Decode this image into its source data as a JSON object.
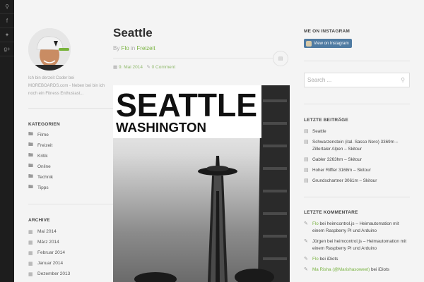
{
  "left_sidebar": {
    "bio": "Ich bin derzeit Coder bei MOREBOARDS.com - Neben bei bin ich noch ein Fitness Enthusiast...",
    "categories_title": "KATEGORIEN",
    "categories": [
      "Filme",
      "Freizeit",
      "Kritik",
      "Online",
      "Technik",
      "Tipps"
    ],
    "archive_title": "ARCHIVE",
    "archive": [
      "Mai 2014",
      "März 2014",
      "Februar 2014",
      "Januar 2014",
      "Dezember 2013"
    ]
  },
  "post": {
    "title": "Seattle",
    "by": "By",
    "author": "Flo",
    "in": "in",
    "category": "Freizeit",
    "date": "9. Mai 2014",
    "comments": "0 Comment",
    "hero_line1": "SEATTLE",
    "hero_line2": "WASHINGTON"
  },
  "right_sidebar": {
    "instagram_title": "ME ON INSTAGRAM",
    "instagram_button": "View on Instagram",
    "search_placeholder": "Search ...",
    "recent_posts_title": "LETZTE BEITRÄGE",
    "recent_posts": [
      "Seattle",
      "Schwarzenstein (ital. Sasso Nero) 3369m – Zillertaler Alpen – Skitour",
      "Gabler 3263hm – Skitour",
      "Hoher Riffler 3168m – Skitour",
      "Grundschartner 3061m – Skitour"
    ],
    "recent_comments_title": "LETZTE KOMMENTARE",
    "recent_comments": [
      {
        "author": "Flo",
        "sep": "bei",
        "post": "heimcontrol.js – Heimautomation mit einem Raspberry PI und Arduino"
      },
      {
        "author": "Jürgen",
        "sep": "bei",
        "post": "heimcontrol.js – Heimautomation mit einem Raspberry PI und Arduino"
      },
      {
        "author": "Flo",
        "sep": "bei",
        "post": "iDiots"
      },
      {
        "author": "Ma Risha (@Marishasoweet)",
        "sep": "bei",
        "post": "iDiots"
      }
    ]
  },
  "colors": {
    "accent": "#79b341",
    "dark_bar": "#1d1d1d",
    "background": "#f4f4f4"
  }
}
